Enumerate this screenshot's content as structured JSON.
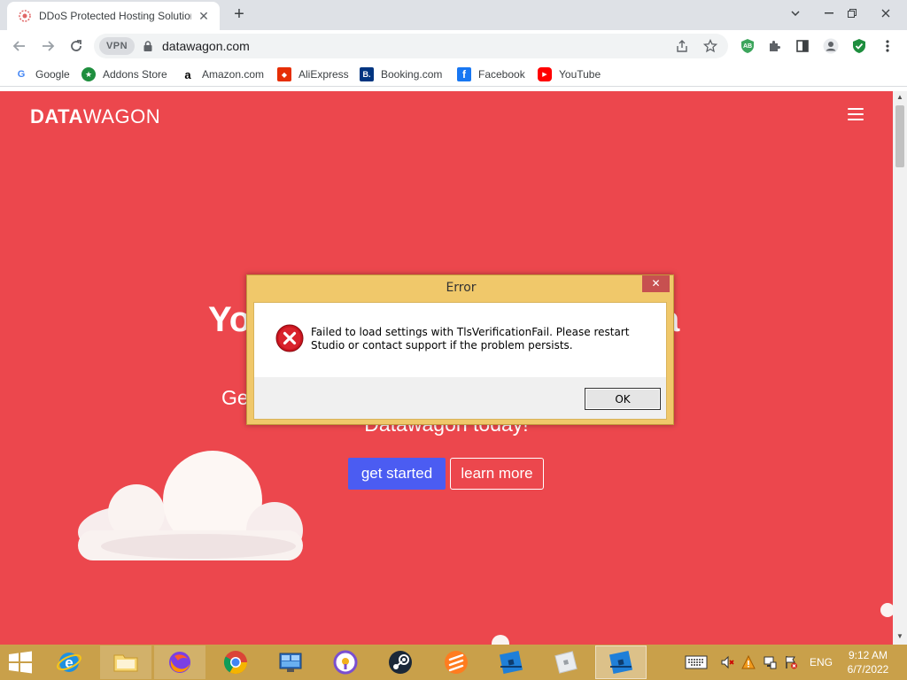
{
  "browser": {
    "tab": {
      "title": "DDoS Protected Hosting Solution",
      "close": "✕"
    },
    "new_tab": "+",
    "address_bar": {
      "vpn_label": "VPN",
      "url": "datawagon.com"
    },
    "extensions": {
      "adblock": "AB"
    },
    "bookmarks": [
      {
        "label": "Google",
        "icon": "google-icon",
        "color": "#4285f4",
        "glyph": "G"
      },
      {
        "label": "Addons Store",
        "icon": "addons-store-icon",
        "color": "#1e8e3e",
        "glyph": "★"
      },
      {
        "label": "Amazon.com",
        "icon": "amazon-icon",
        "color": "#000000",
        "glyph": "a"
      },
      {
        "label": "AliExpress",
        "icon": "aliexpress-icon",
        "color": "#e62e04",
        "glyph": "◆"
      },
      {
        "label": "Booking.com",
        "icon": "booking-icon",
        "color": "#003580",
        "glyph": "B."
      },
      {
        "label": "Facebook",
        "icon": "facebook-icon",
        "color": "#1877f2",
        "glyph": "f"
      },
      {
        "label": "YouTube",
        "icon": "youtube-icon",
        "color": "#ff0000",
        "glyph": "▶"
      }
    ]
  },
  "page": {
    "logo_bold": "DATA",
    "logo_light": "WAGON",
    "hero_heading_left": "Yo",
    "hero_heading_right": "a",
    "hero_sub_left": "Ge",
    "hero_sub_bottom": "Datawagon today!",
    "get_started": "get started",
    "learn_more": "learn more",
    "bg_color": "#ec474d"
  },
  "dialog": {
    "title": "Error",
    "close": "✕",
    "message": "Failed to load settings with TlsVerificationFail. Please restart Studio or contact support if the problem persists.",
    "ok": "OK"
  },
  "taskbar": {
    "apps": [
      {
        "name": "internet-explorer"
      },
      {
        "name": "file-explorer"
      },
      {
        "name": "firefox"
      },
      {
        "name": "chrome"
      },
      {
        "name": "control-panel"
      },
      {
        "name": "browser-app"
      },
      {
        "name": "steam"
      },
      {
        "name": "sublime"
      },
      {
        "name": "roblox-studio"
      },
      {
        "name": "roblox"
      },
      {
        "name": "roblox-studio-active"
      }
    ],
    "language": "ENG",
    "time": "9:12 AM",
    "date": "6/7/2022"
  }
}
